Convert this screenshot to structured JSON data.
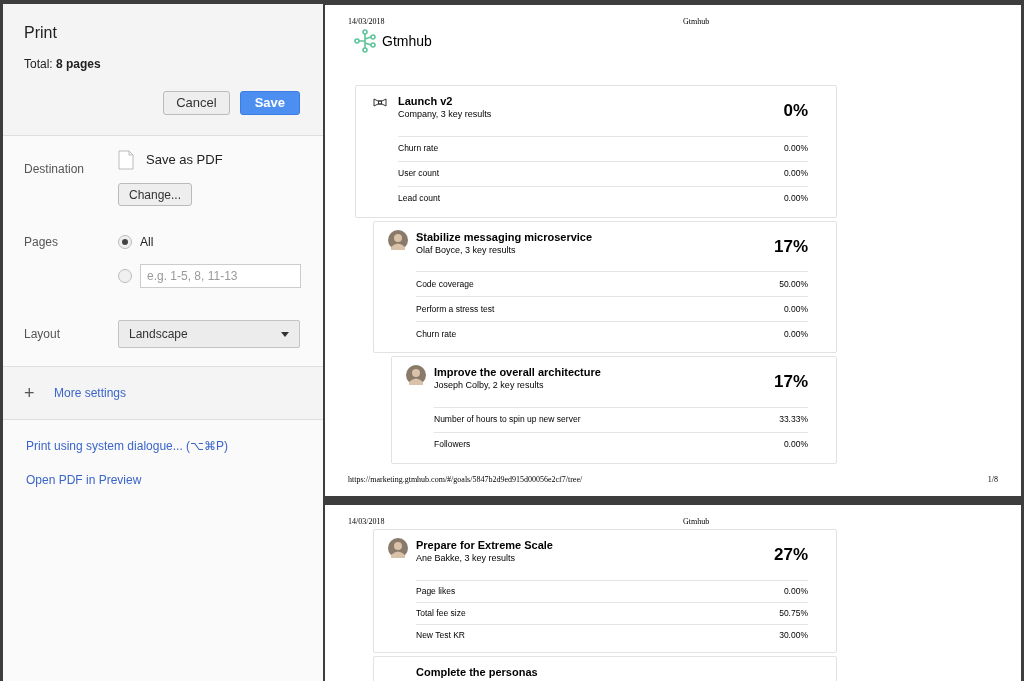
{
  "dialog": {
    "title": "Print",
    "total_label": "Total:",
    "total_value": "8 pages",
    "buttons": [
      {
        "label": "Cancel",
        "kind": "secondary"
      },
      {
        "label": "Save",
        "kind": "primary"
      }
    ],
    "destination": {
      "label": "Destination",
      "name": "Save as PDF",
      "change": "Change..."
    },
    "pages": {
      "label": "Pages",
      "options": [
        {
          "label": "All",
          "selected": true
        },
        {
          "placeholder": "e.g. 1-5, 8, 11-13",
          "selected": false
        }
      ]
    },
    "layout": {
      "label": "Layout",
      "value": "Landscape"
    },
    "more_settings": {
      "icon": "+",
      "label": "More settings",
      "expanded": false
    },
    "links": [
      "Print using system dialogue... (⌥⌘P)",
      "Open PDF in Preview"
    ]
  },
  "preview": {
    "pages": [
      {
        "header_date": "14/03/2018",
        "header_title": "Gtmhub",
        "logo_text": "Gtmhub",
        "footer_url": "https://marketing.gtmhub.com/#/goals/5847b2d9ed915d00056e2cf7/tree/",
        "page_number": "1/8",
        "objectives": [
          {
            "kind": "company",
            "title": "Launch v2",
            "subtitle": "Company, 3 key results",
            "percent": "0%",
            "key_results": [
              {
                "name": "Churn rate",
                "value": "0.00%"
              },
              {
                "name": "User count",
                "value": "0.00%"
              },
              {
                "name": "Lead count",
                "value": "0.00%"
              }
            ],
            "children": [
              {
                "kind": "person",
                "title": "Stabilize messaging microservice",
                "subtitle": "Olaf Boyce, 3 key results",
                "percent": "17%",
                "key_results": [
                  {
                    "name": "Code coverage",
                    "value": "50.00%"
                  },
                  {
                    "name": "Perform a stress test",
                    "value": "0.00%"
                  },
                  {
                    "name": "Churn rate",
                    "value": "0.00%"
                  }
                ],
                "children": [
                  {
                    "kind": "person",
                    "title": "Improve the overall architecture",
                    "subtitle": "Joseph Colby, 2 key results",
                    "percent": "17%",
                    "key_results": [
                      {
                        "name": "Number of hours to spin up new server",
                        "value": "33.33%"
                      },
                      {
                        "name": "Followers",
                        "value": "0.00%"
                      }
                    ]
                  }
                ]
              }
            ]
          }
        ]
      },
      {
        "header_date": "14/03/2018",
        "header_title": "Gtmhub",
        "objectives": [
          {
            "kind": "person",
            "title": "Prepare for Extreme Scale",
            "subtitle": "Ane Bakke, 3 key results",
            "percent": "27%",
            "key_results": [
              {
                "name": "Page likes",
                "value": "0.00%"
              },
              {
                "name": "Total fee size",
                "value": "50.75%"
              },
              {
                "name": "New Test KR",
                "value": "30.00%"
              }
            ]
          },
          {
            "kind": "none",
            "title": "Complete the personas"
          }
        ]
      }
    ]
  }
}
